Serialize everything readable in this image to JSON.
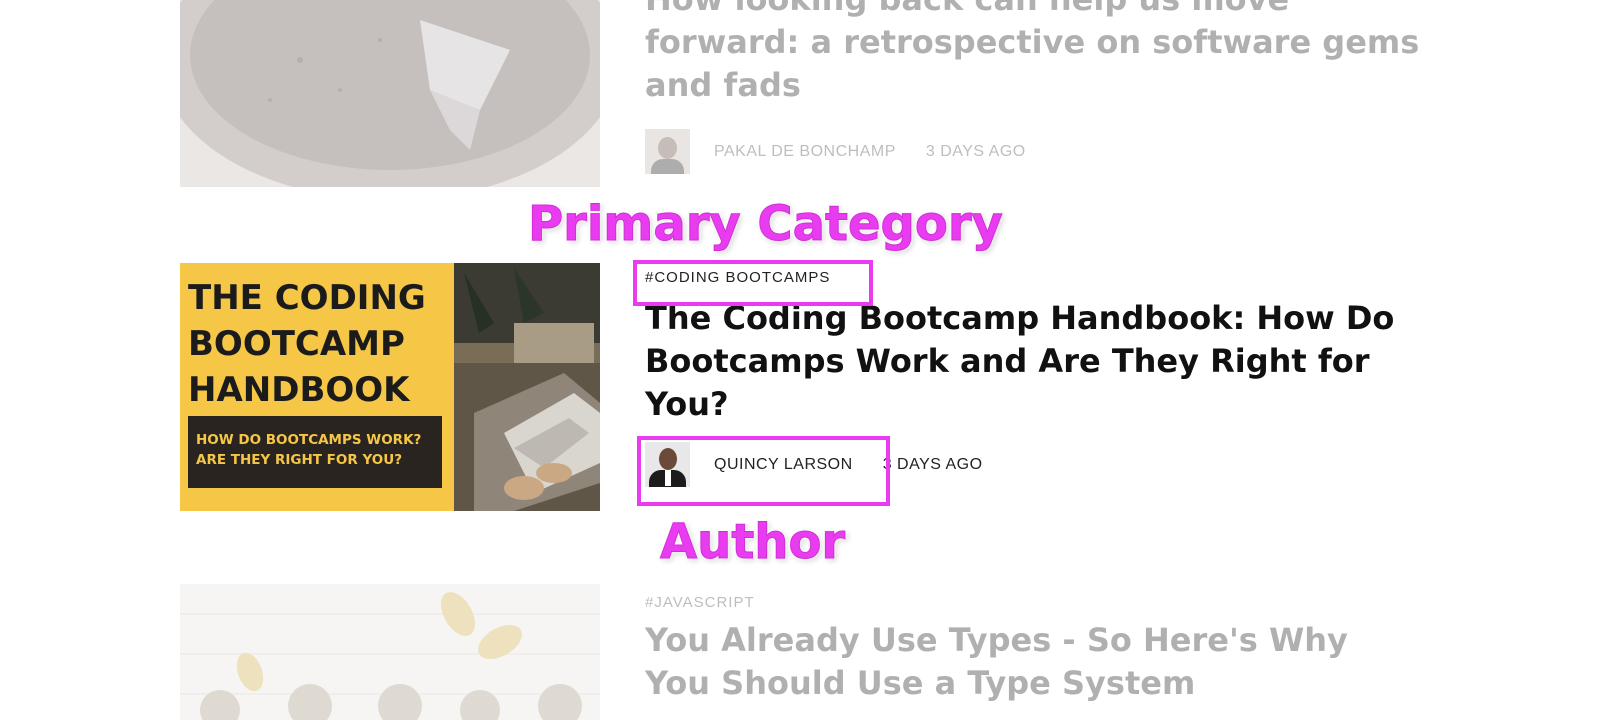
{
  "posts": [
    {
      "title": "How looking back can help us move forward: a retrospective on software gems and fads",
      "author": "PAKAL DE BONCHAMP",
      "date": "3 DAYS AGO"
    },
    {
      "tag": "#CODING BOOTCAMPS",
      "title": "The Coding Bootcamp Handbook: How Do Bootcamps Work and Are They Right for You?",
      "author": "QUINCY LARSON",
      "date": "3 DAYS AGO",
      "image": {
        "heading": "THE CODING BOOTCAMP HANDBOOK",
        "subheading": "HOW DO BOOTCAMPS WORK? ARE THEY RIGHT FOR YOU?",
        "bg_color": "#f6c746",
        "box_color": "#2a2420"
      }
    },
    {
      "tag": "#JAVASCRIPT",
      "title": "You Already Use Types - So Here's Why You Should Use a Type System"
    }
  ],
  "annotations": {
    "category_label": "Primary Category",
    "author_label": "Author",
    "color": "#e93cf0"
  }
}
